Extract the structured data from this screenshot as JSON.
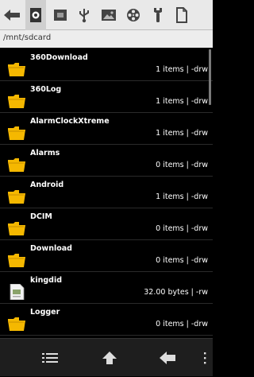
{
  "toolbar": {
    "buttons": [
      {
        "icon": "back-arrow-icon"
      },
      {
        "icon": "sdcard-icon"
      },
      {
        "icon": "sim-card-icon"
      },
      {
        "icon": "usb-icon"
      },
      {
        "icon": "image-icon"
      },
      {
        "icon": "film-reel-icon"
      },
      {
        "icon": "wrench-icon"
      },
      {
        "icon": "document-icon"
      }
    ],
    "selected_index": 1
  },
  "path": "/mnt/sdcard",
  "files": [
    {
      "name": "360Download",
      "info": "1 items | -drw",
      "type": "folder"
    },
    {
      "name": "360Log",
      "info": "1 items | -drw",
      "type": "folder"
    },
    {
      "name": "AlarmClockXtreme",
      "info": "1 items | -drw",
      "type": "folder"
    },
    {
      "name": "Alarms",
      "info": "0 items | -drw",
      "type": "folder"
    },
    {
      "name": "Android",
      "info": "1 items | -drw",
      "type": "folder"
    },
    {
      "name": "DCIM",
      "info": "0 items | -drw",
      "type": "folder"
    },
    {
      "name": "Download",
      "info": "0 items | -drw",
      "type": "folder"
    },
    {
      "name": "kingdid",
      "info": "32.00 bytes  | -rw",
      "type": "file"
    },
    {
      "name": "Logger",
      "info": "0 items | -drw",
      "type": "folder"
    }
  ],
  "bottombar": {
    "buttons": [
      {
        "icon": "list-icon"
      },
      {
        "icon": "up-arrow-icon"
      },
      {
        "icon": "back-arrow-icon"
      },
      {
        "icon": "overflow-menu-icon"
      }
    ]
  },
  "colors": {
    "folder": "#f5b800",
    "toolbar_bg": "#e9e9e9",
    "list_bg": "#000000",
    "icon_dark": "#444444"
  }
}
